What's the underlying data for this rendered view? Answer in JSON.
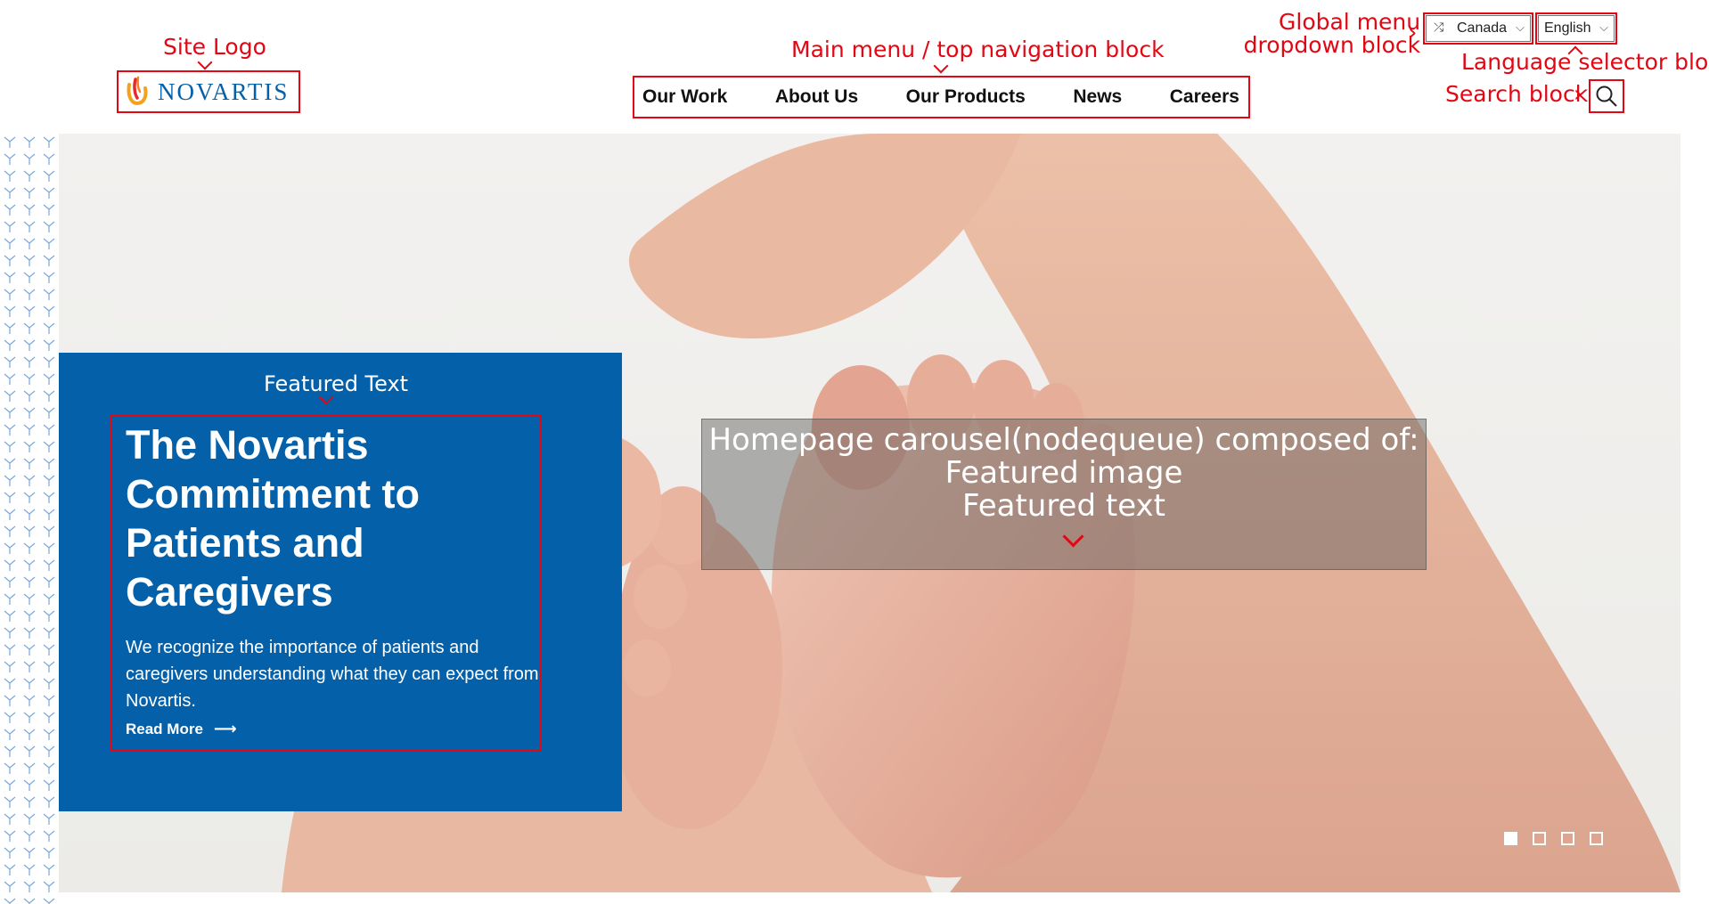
{
  "header": {
    "logo_text": "NOVARTIS",
    "nav": [
      {
        "label": "Our Work"
      },
      {
        "label": "About Us"
      },
      {
        "label": "Our Products"
      },
      {
        "label": "News"
      },
      {
        "label": "Careers"
      }
    ],
    "country_select": {
      "value": "Canada",
      "icon": "shuffle-icon"
    },
    "language_select": {
      "value": "English"
    },
    "search_icon": "search-icon"
  },
  "hero": {
    "title": "The Novartis Commitment to Patients and Caregivers",
    "description": "We recognize the importance of patients and caregivers understanding what they can expect from Novartis.",
    "read_more": "Read More",
    "carousel_slide_count": 4,
    "active_slide": 1
  },
  "annotations": {
    "site_logo": "Site Logo",
    "main_menu": "Main menu / top navigation block",
    "global_menu_line1": "Global menu",
    "global_menu_line2": "dropdown block",
    "language_selector": "Language selector block",
    "search_block": "Search block",
    "featured_text": "Featured Text",
    "carousel_line1": "Homepage carousel(nodequeue) composed of:",
    "carousel_line2": "Featured image",
    "carousel_line3": "Featured text"
  },
  "colors": {
    "brand_blue": "#0460a9",
    "annotation_red": "#e30613"
  }
}
